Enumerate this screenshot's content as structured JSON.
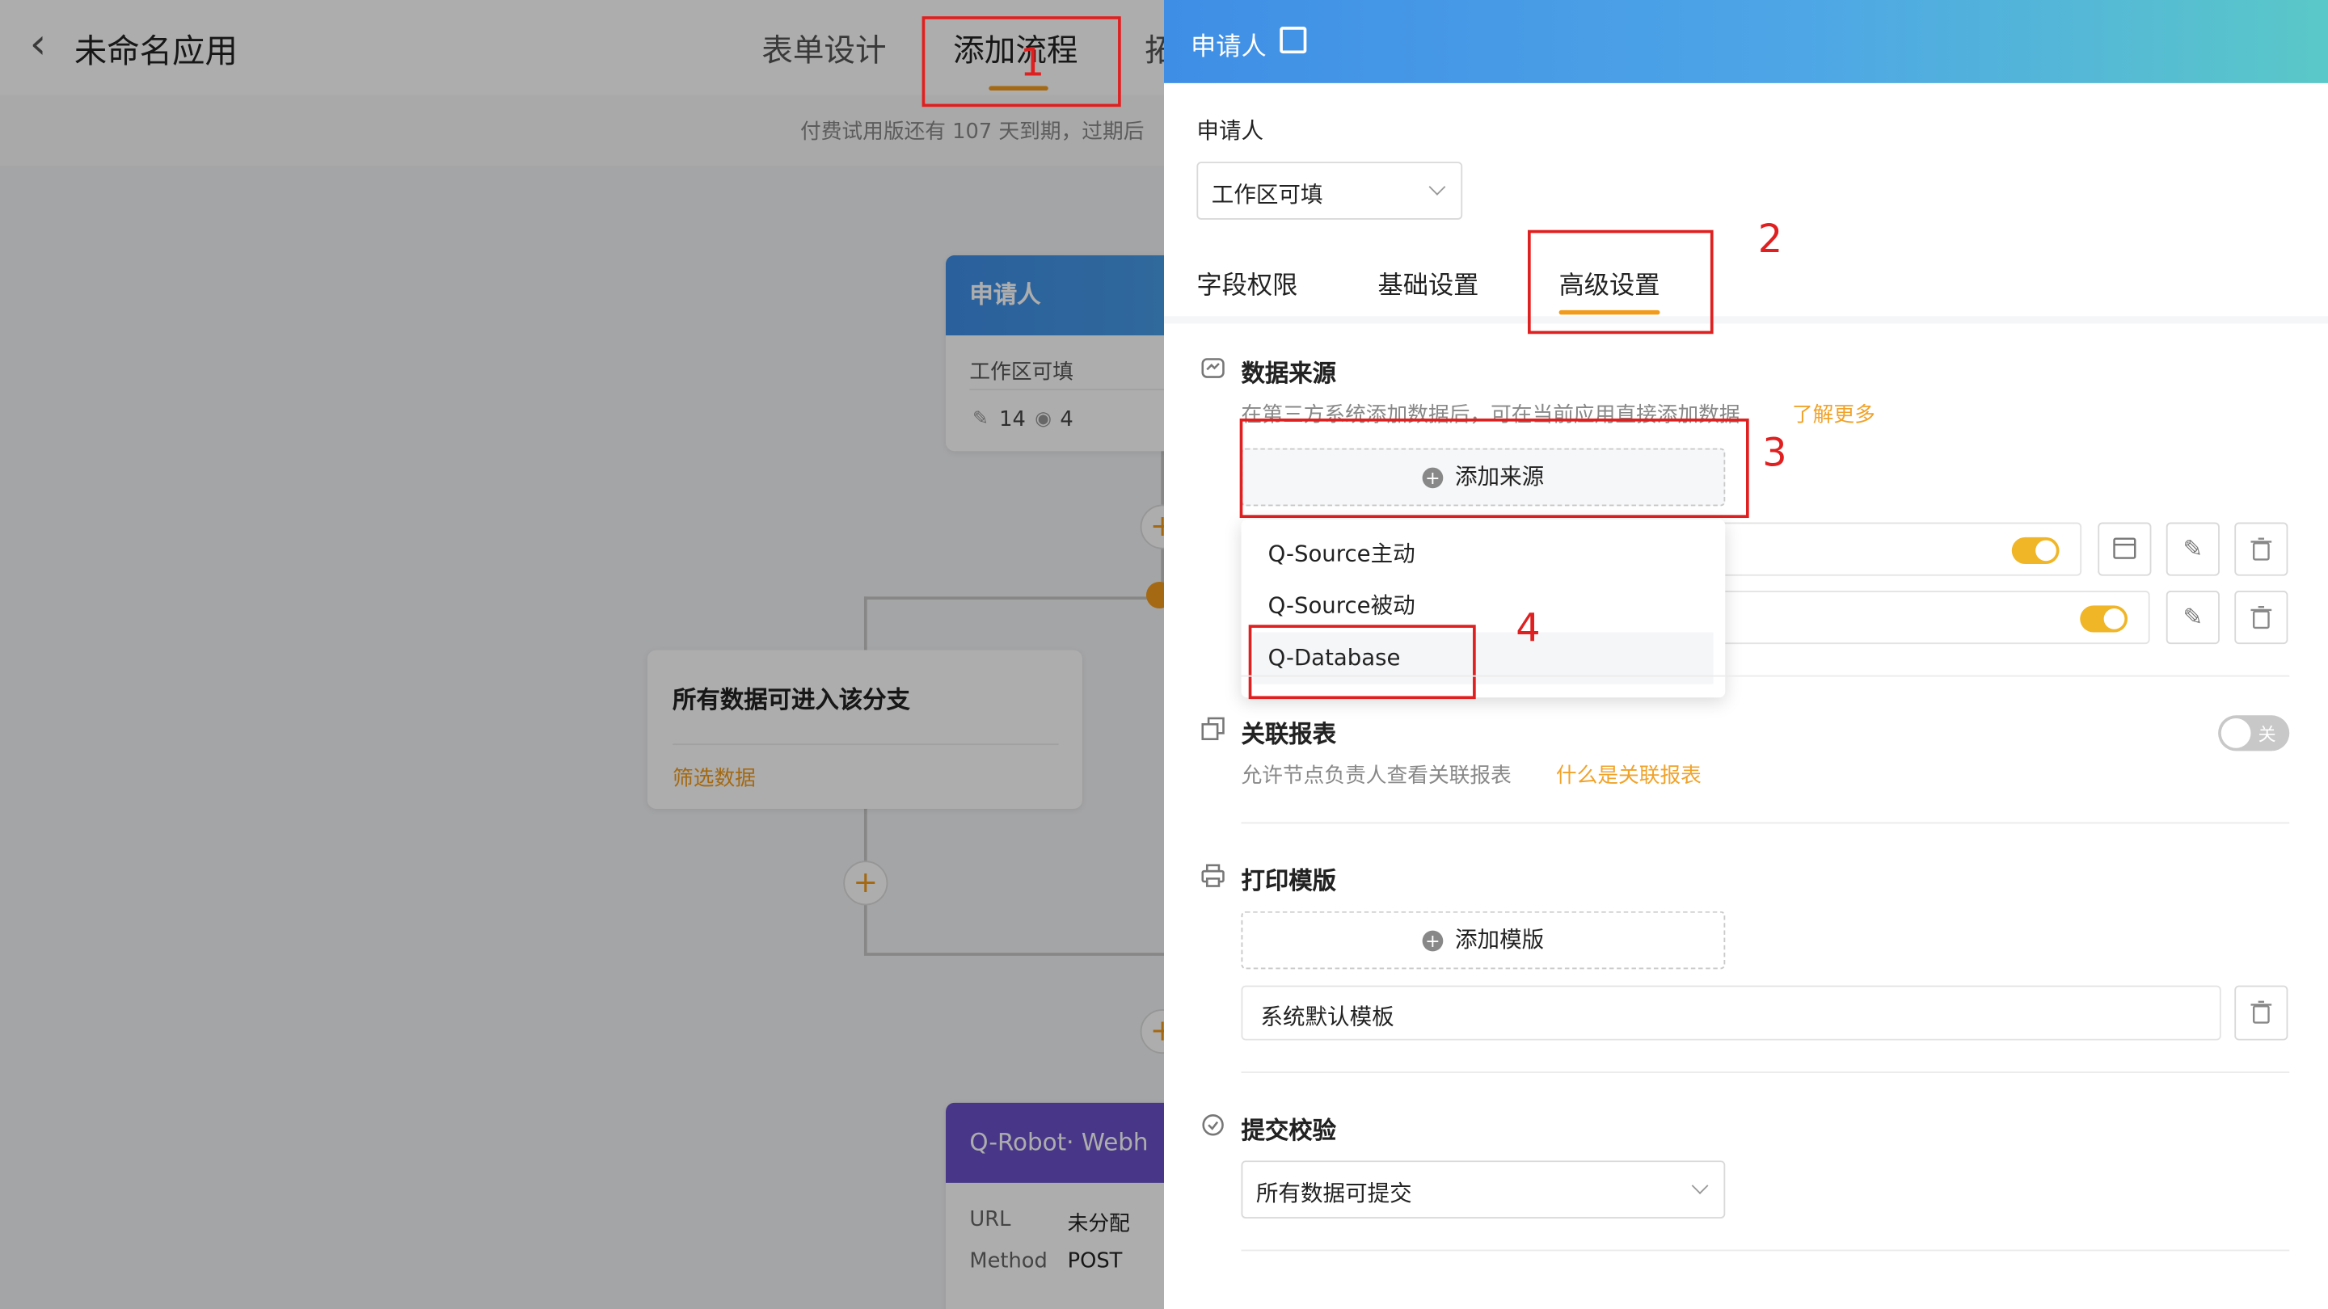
{
  "app": {
    "back_label": "‹",
    "title": "未命名应用",
    "tabs": [
      "表单设计",
      "添加流程",
      "拓"
    ],
    "notice": "付费试用版还有 107 天到期，过期后"
  },
  "flow": {
    "applicant_node": {
      "title": "申请人",
      "subtitle": "工作区可填",
      "edit_count": "14",
      "view_count": "4"
    },
    "branch_node": {
      "title": "所有数据可进入该分支",
      "filter_link": "筛选数据"
    },
    "robot_node": {
      "title": "Q-Robot· Webh",
      "rows": [
        {
          "key": "URL",
          "value": "未分配"
        },
        {
          "key": "Method",
          "value": "POST"
        }
      ]
    }
  },
  "drawer": {
    "title": "申请人",
    "field_label": "申请人",
    "select_value": "工作区可填",
    "tabs": [
      "字段权限",
      "基础设置",
      "高级设置"
    ],
    "active_tab": "高级设置",
    "data_source": {
      "title": "数据来源",
      "desc": "在第三方系统添加数据后，可在当前应用直接添加数据",
      "learn_more": "了解更多",
      "add_button": "添加来源",
      "menu": [
        "Q-Source主动",
        "Q-Source被动",
        "Q-Database"
      ]
    },
    "related_report": {
      "title": "关联报表",
      "desc": "允许节点负责人查看关联报表",
      "link": "什么是关联报表",
      "toggle_label": "关"
    },
    "print_template": {
      "title": "打印模版",
      "add_button": "添加模版",
      "default_template": "系统默认模板"
    },
    "submit_check": {
      "title": "提交校验",
      "select_value": "所有数据可提交"
    }
  },
  "annotations": [
    "1",
    "2",
    "3",
    "4"
  ],
  "colors": {
    "accent": "#f29b1b",
    "annotation_red": "#e02020",
    "drawer_gradient_start": "#3f8ee6",
    "drawer_gradient_end": "#5ac8c8",
    "robot_purple": "#6b52c9"
  }
}
